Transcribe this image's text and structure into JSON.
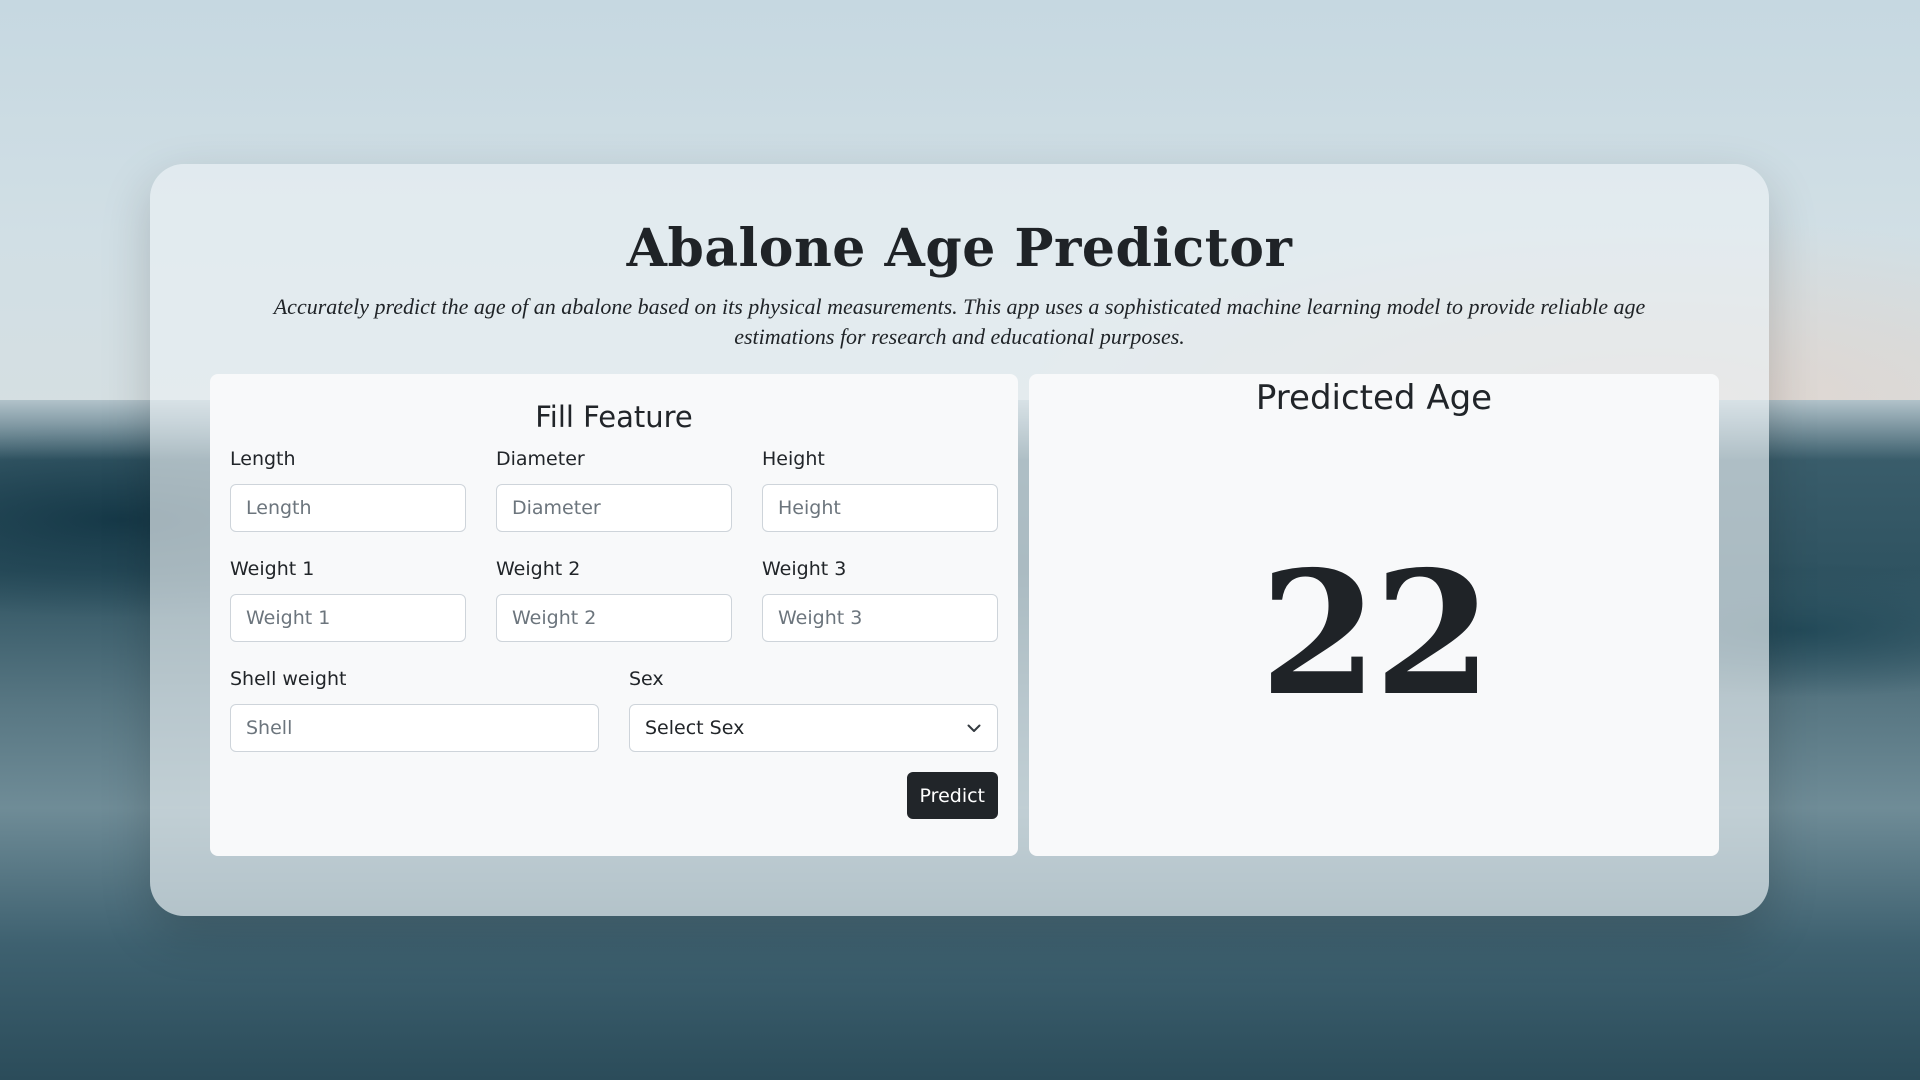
{
  "app": {
    "title": "Abalone Age Predictor",
    "subtitle": "Accurately predict the age of an abalone based on its physical measurements. This app uses a sophisticated machine learning model to provide reliable age estimations for research and educational purposes."
  },
  "form": {
    "title": "Fill Feature",
    "fields": {
      "length": {
        "label": "Length",
        "placeholder": "Length",
        "value": ""
      },
      "diameter": {
        "label": "Diameter",
        "placeholder": "Diameter",
        "value": ""
      },
      "height": {
        "label": "Height",
        "placeholder": "Height",
        "value": ""
      },
      "weight1": {
        "label": "Weight 1",
        "placeholder": "Weight 1",
        "value": ""
      },
      "weight2": {
        "label": "Weight 2",
        "placeholder": "Weight 2",
        "value": ""
      },
      "weight3": {
        "label": "Weight 3",
        "placeholder": "Weight 3",
        "value": ""
      },
      "shell": {
        "label": "Shell weight",
        "placeholder": "Shell",
        "value": ""
      },
      "sex": {
        "label": "Sex",
        "selected": "Select Sex",
        "icon": "chevron-down-icon"
      }
    },
    "predict_label": "Predict"
  },
  "result": {
    "title": "Predicted Age",
    "value": "22"
  },
  "colors": {
    "text": "#212529",
    "button": "#212529",
    "card": "#f8f9fa",
    "input_border": "#ced4da"
  }
}
